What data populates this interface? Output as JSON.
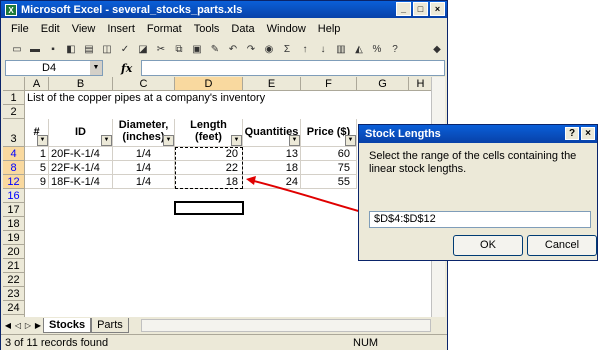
{
  "window": {
    "title": "Microsoft Excel - several_stocks_parts.xls",
    "controls": [
      "_",
      "□",
      "×"
    ]
  },
  "menu": [
    "File",
    "Edit",
    "View",
    "Insert",
    "Format",
    "Tools",
    "Data",
    "Window",
    "Help"
  ],
  "formula_bar": {
    "name_box": "D4",
    "fx": "fx"
  },
  "columns": [
    "A",
    "B",
    "C",
    "D",
    "E",
    "F",
    "G",
    "H"
  ],
  "rows": [
    {
      "num": "1",
      "cells": [
        "List of the copper pipes at a company's inventory",
        "",
        "",
        "",
        "",
        "",
        ""
      ]
    },
    {
      "num": "2",
      "cells": [
        "",
        "",
        "",
        "",
        "",
        "",
        ""
      ]
    },
    {
      "num": "3",
      "cells": [
        "#",
        "ID",
        "Diameter, (inches)",
        "Length (feet)",
        "Quantities",
        "Price ($)",
        ""
      ]
    },
    {
      "num": "4",
      "cells": [
        "1",
        "20F-K-1/4",
        "1/4",
        "20",
        "13",
        "60",
        ""
      ]
    },
    {
      "num": "8",
      "cells": [
        "5",
        "22F-K-1/4",
        "1/4",
        "22",
        "18",
        "75",
        ""
      ]
    },
    {
      "num": "12",
      "cells": [
        "9",
        "18F-K-1/4",
        "1/4",
        "18",
        "24",
        "55",
        ""
      ]
    },
    {
      "num": "16",
      "cells": []
    },
    {
      "num": "17",
      "cells": []
    },
    {
      "num": "18",
      "cells": []
    },
    {
      "num": "19",
      "cells": []
    },
    {
      "num": "20",
      "cells": []
    },
    {
      "num": "21",
      "cells": []
    },
    {
      "num": "22",
      "cells": []
    },
    {
      "num": "23",
      "cells": []
    },
    {
      "num": "24",
      "cells": []
    },
    {
      "num": "25",
      "cells": []
    }
  ],
  "header_labels": {
    "col_a": "#",
    "col_b": "ID",
    "col_c_line1": "Diameter,",
    "col_c_line2": "(inches)",
    "col_d_line1": "Length",
    "col_d_line2": "(feet)",
    "col_e": "Quantities",
    "col_f": "Price ($)"
  },
  "sheet_tabs": [
    "Stocks",
    "Parts"
  ],
  "status": {
    "left": "3 of 11 records found",
    "mode": "NUM"
  },
  "dialog": {
    "title": "Stock Lengths",
    "prompt": "Select the range of the cells containing the linear stock lengths.",
    "input_value": "$D$4:$D$12",
    "ok_label": "OK",
    "cancel_label": "Cancel",
    "help": "?",
    "close": "×"
  },
  "colors": {
    "annotation": "#E00000",
    "title_gradient_top": "#0A5FD8",
    "filtered_row_number": "#0000FF"
  }
}
